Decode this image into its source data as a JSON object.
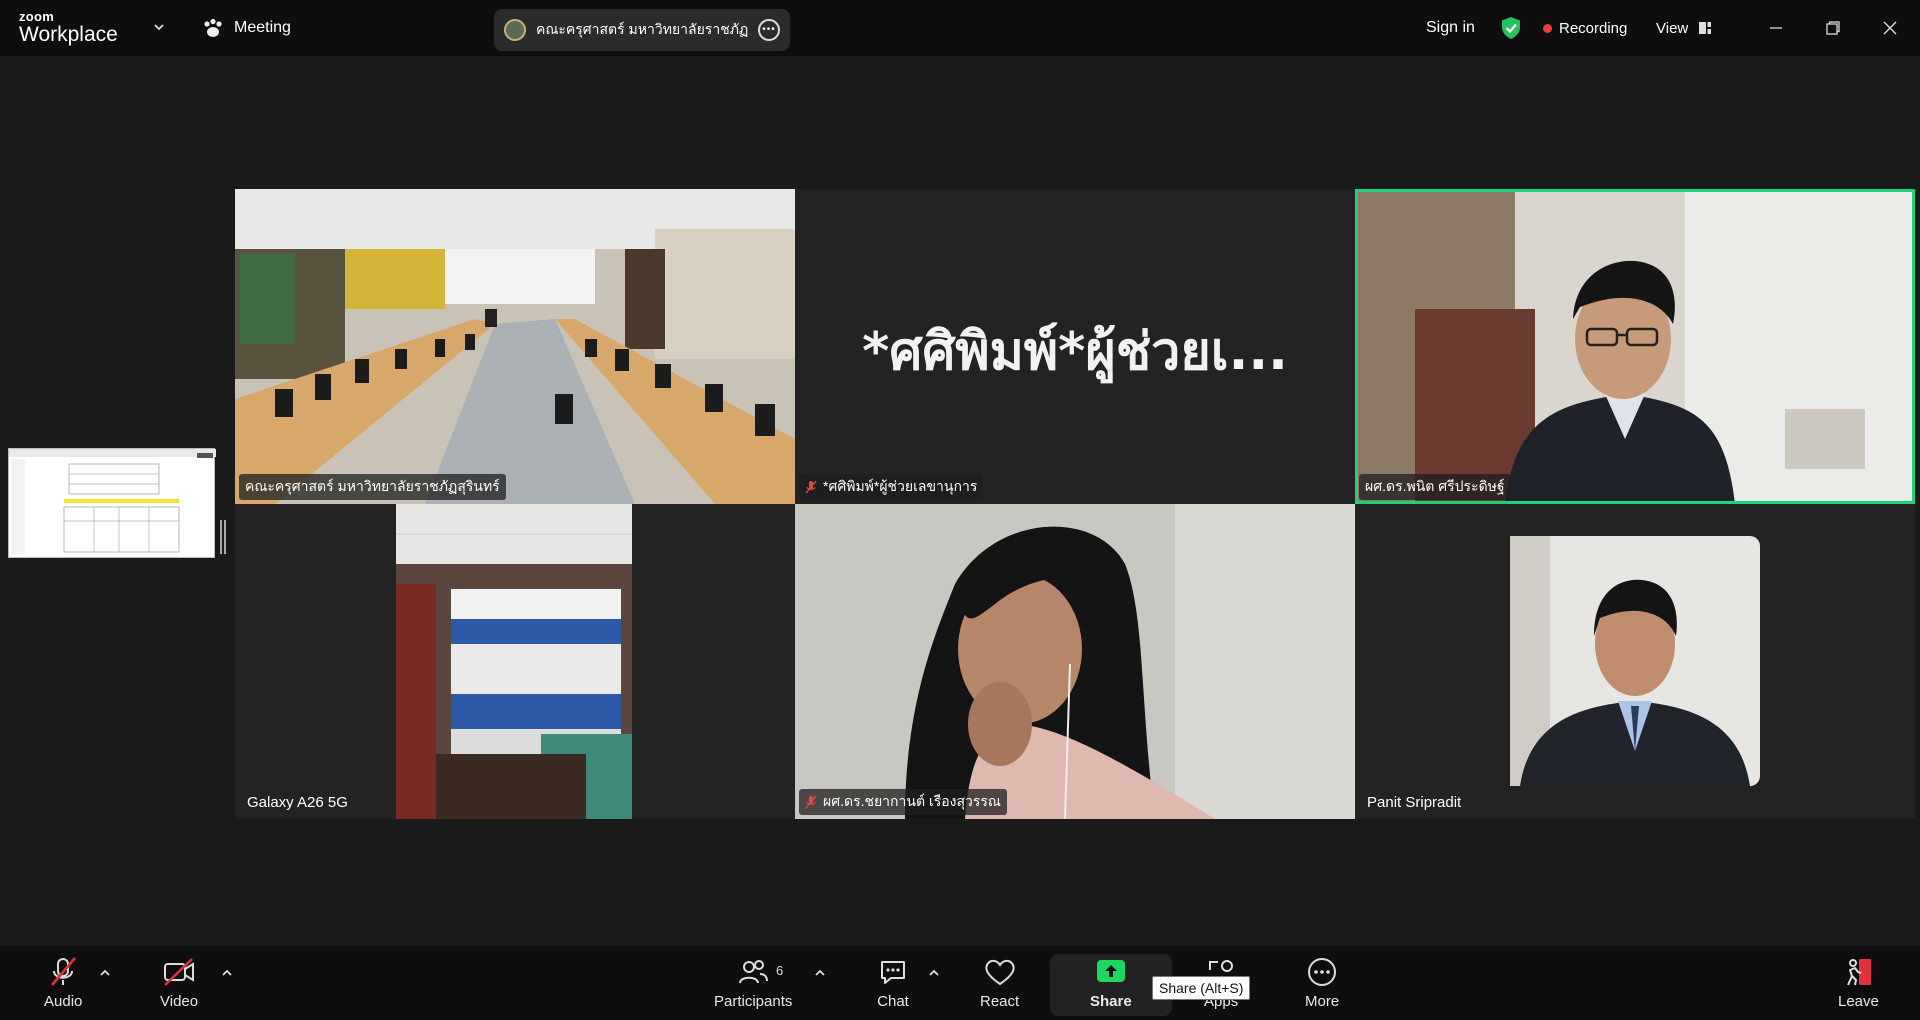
{
  "app": {
    "logo_line1": "zoom",
    "logo_line2": "Workplace"
  },
  "titlebar": {
    "meeting_menu_label": "Meeting",
    "meeting_tab_title": "คณะครุศาสตร์ มหาวิทยาลัยราชภัฏสุริ",
    "sign_in_label": "Sign in",
    "recording_label": "Recording",
    "view_label": "View"
  },
  "participants_grid": [
    {
      "name": "คณะครุศาสตร์ มหาวิทยาลัยราชภัฏสุรินทร์",
      "muted": false,
      "video": true,
      "active": false
    },
    {
      "name": "*ศศิพิมพ์*ผู้ช่วยเลขานุการ",
      "display_name": "*ศศิพิมพ์*ผู้ช่วยเ...",
      "muted": true,
      "video": false,
      "active": false
    },
    {
      "name": "ผศ.ดร.พนิต ศรีประดิษฐ์",
      "muted": false,
      "video": true,
      "active": true
    },
    {
      "name": "Galaxy A26 5G",
      "muted": false,
      "video": true,
      "active": false
    },
    {
      "name": "ผศ.ดร.ชยากานต์ เรืองสุวรรณ",
      "muted": true,
      "video": true,
      "active": false
    },
    {
      "name": "Panit Sripradit",
      "muted": false,
      "video": true,
      "active": false
    }
  ],
  "toolbar": {
    "audio_label": "Audio",
    "video_label": "Video",
    "participants_label": "Participants",
    "participants_count": "6",
    "chat_label": "Chat",
    "react_label": "React",
    "share_label": "Share",
    "apps_label": "Apps",
    "more_label": "More",
    "leave_label": "Leave",
    "share_tooltip": "Share (Alt+S)"
  },
  "colors": {
    "accent_green": "#21d177",
    "share_green": "#1ed760",
    "recording_red": "#ee3d3d",
    "leave_red": "#e0313c"
  }
}
